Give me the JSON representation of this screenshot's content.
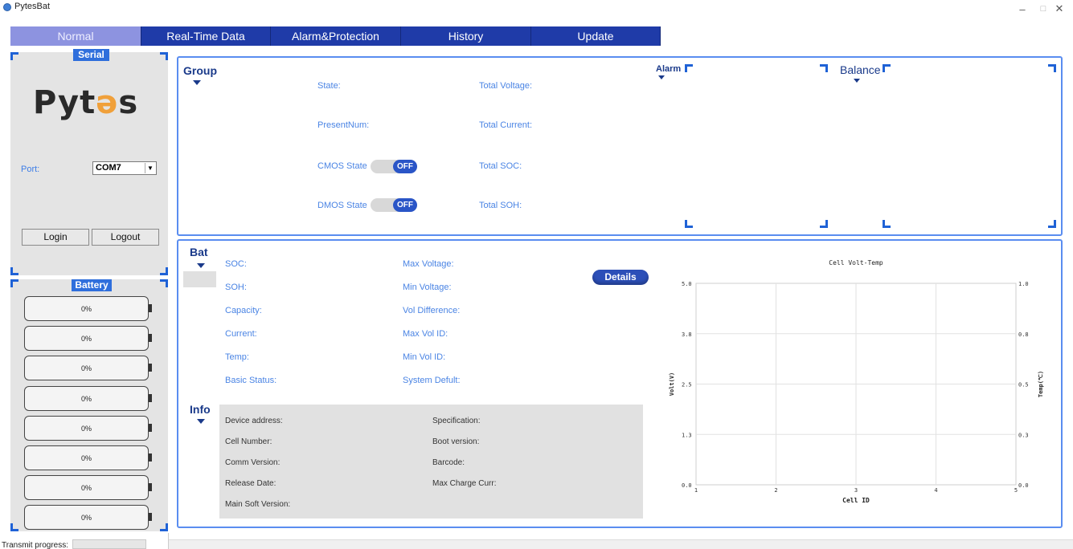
{
  "window": {
    "title": "PytesBat",
    "minimize": "–",
    "maximize": "□",
    "close": "✕"
  },
  "tabs": [
    "Normal",
    "Real-Time Data",
    "Alarm&Protection",
    "History",
    "Update"
  ],
  "serial": {
    "header": "Serial",
    "logo_a": "Pyt",
    "logo_e": "ə",
    "logo_b": "s",
    "port_label": "Port:",
    "port_value": "COM7",
    "login": "Login",
    "logout": "Logout"
  },
  "battery": {
    "header": "Battery",
    "cells": [
      "0%",
      "0%",
      "0%",
      "0%",
      "0%",
      "0%",
      "0%",
      "0%"
    ]
  },
  "group": {
    "title": "Group",
    "state": "State:",
    "present_num": "PresentNum:",
    "cmos_state": "CMOS State",
    "dmos_state": "DMOS State",
    "cmos_toggle": "OFF",
    "dmos_toggle": "OFF",
    "total_voltage": "Total Voltage:",
    "total_current": "Total Current:",
    "total_soc": "Total SOC:",
    "total_soh": "Total SOH:",
    "alarm": "Alarm",
    "balance": "Balance"
  },
  "bat": {
    "title": "Bat",
    "soc": "SOC:",
    "soh": "SOH:",
    "capacity": "Capacity:",
    "current": "Current:",
    "temp": "Temp:",
    "basic_status": "Basic Status:",
    "max_voltage": "Max Voltage:",
    "min_voltage": "Min Voltage:",
    "vol_difference": "Vol Difference:",
    "max_vol_id": "Max Vol ID:",
    "min_vol_id": "Min Vol ID:",
    "system_default": "System Defult:",
    "details": "Details"
  },
  "info": {
    "title": "Info",
    "device_address": "Device address:",
    "cell_number": "Cell Number:",
    "comm_version": "Comm Version:",
    "release_date": "Release Date:",
    "main_soft_version": "Main Soft Version:",
    "specification": "Specification:",
    "boot_version": "Boot version:",
    "barcode": "Barcode:",
    "max_charge_curr": "Max Charge Curr:"
  },
  "status": {
    "transmit_progress": "Transmit progress:"
  },
  "chart_data": {
    "type": "line",
    "title": "Cell Volt-Temp",
    "xlabel": "Cell ID",
    "ylabel": "Volt(V)",
    "y2label": "Temp(℃)",
    "x_ticks": [
      "1",
      "2",
      "3",
      "4",
      "5"
    ],
    "y_ticks": [
      "0.0",
      "1.3",
      "2.5",
      "3.8",
      "5.0"
    ],
    "y2_ticks": [
      "0.0",
      "0.3",
      "0.5",
      "0.8",
      "1.0"
    ],
    "xlim": [
      1,
      5
    ],
    "ylim": [
      0,
      5
    ],
    "y2lim": [
      0,
      1
    ],
    "grid": true,
    "series": []
  }
}
